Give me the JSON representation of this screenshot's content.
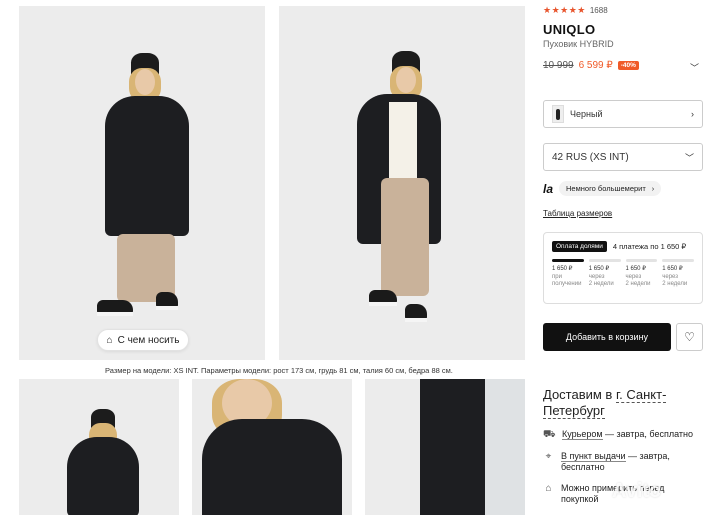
{
  "gallery": {
    "wear_button_label": "С чем носить",
    "model_note": "Размер на модели: XS INT. Параметры модели: рост 173 см, грудь 81 см, талия 60 см, бедра 88 см."
  },
  "product": {
    "rating_count": "1688",
    "rating_stars": "★★★★★",
    "brand": "UNIQLO",
    "name": "Пуховик HYBRID",
    "old_price": "10 999",
    "new_price": "6 599 ₽",
    "discount": "-40%"
  },
  "color_select": {
    "value": "Черный"
  },
  "size_select": {
    "value": "42 RUS (XS INT)"
  },
  "fit": {
    "logo": "la",
    "label": "Немного большемерит",
    "size_table": "Таблица размеров"
  },
  "installments": {
    "badge": "Оплата долями",
    "summary": "4 платежа по 1 650 ₽",
    "progress_fraction": 0.25,
    "payments": [
      {
        "amount": "1 650 ₽",
        "when1": "при",
        "when2": "получении"
      },
      {
        "amount": "1 650 ₽",
        "when1": "через",
        "when2": "2 недели"
      },
      {
        "amount": "1 650 ₽",
        "when1": "через",
        "when2": "2 недели"
      },
      {
        "amount": "1 650 ₽",
        "when1": "через",
        "when2": "2 недели"
      }
    ]
  },
  "actions": {
    "add_to_cart": "Добавить в корзину"
  },
  "delivery": {
    "title_prefix": "Доставим в ",
    "city": "г. Санкт-Петербург",
    "courier_link": "Курьером",
    "courier_rest": " — завтра, бесплатно",
    "pickup_link": "В пункт выдачи",
    "pickup_rest": " — завтра, бесплатно",
    "fitting_text": "Можно примерить перед покупкой"
  },
  "watermark": "Avito",
  "colors": {
    "accent": "#f05a28",
    "dark": "#111111"
  }
}
